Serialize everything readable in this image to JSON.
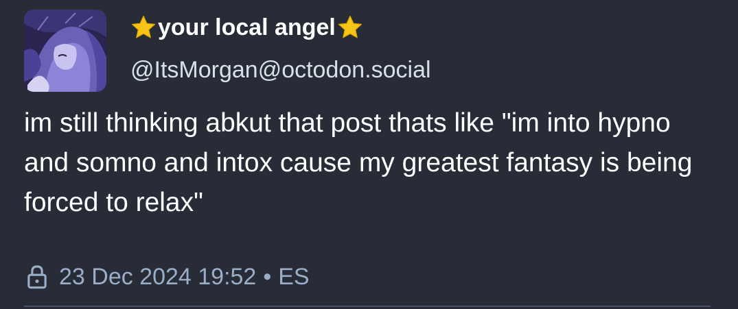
{
  "post": {
    "display_name": "your local angel",
    "handle": "@ItsMorgan@octodon.social",
    "content": "im still thinking abkut that post thats like \"im into hypno and somno and intox cause my greatest fantasy is being forced to relax\"",
    "timestamp": "23 Dec 2024 19:52",
    "separator": "•",
    "language": "ES",
    "visibility_icon": "lock-icon",
    "name_decoration_icon": "star-icon"
  },
  "colors": {
    "background": "#282c37",
    "text": "#ffffff",
    "handle": "#d9e1e8",
    "meta": "#9baec8",
    "star": "#f5c518",
    "divider": "#4a5066"
  }
}
